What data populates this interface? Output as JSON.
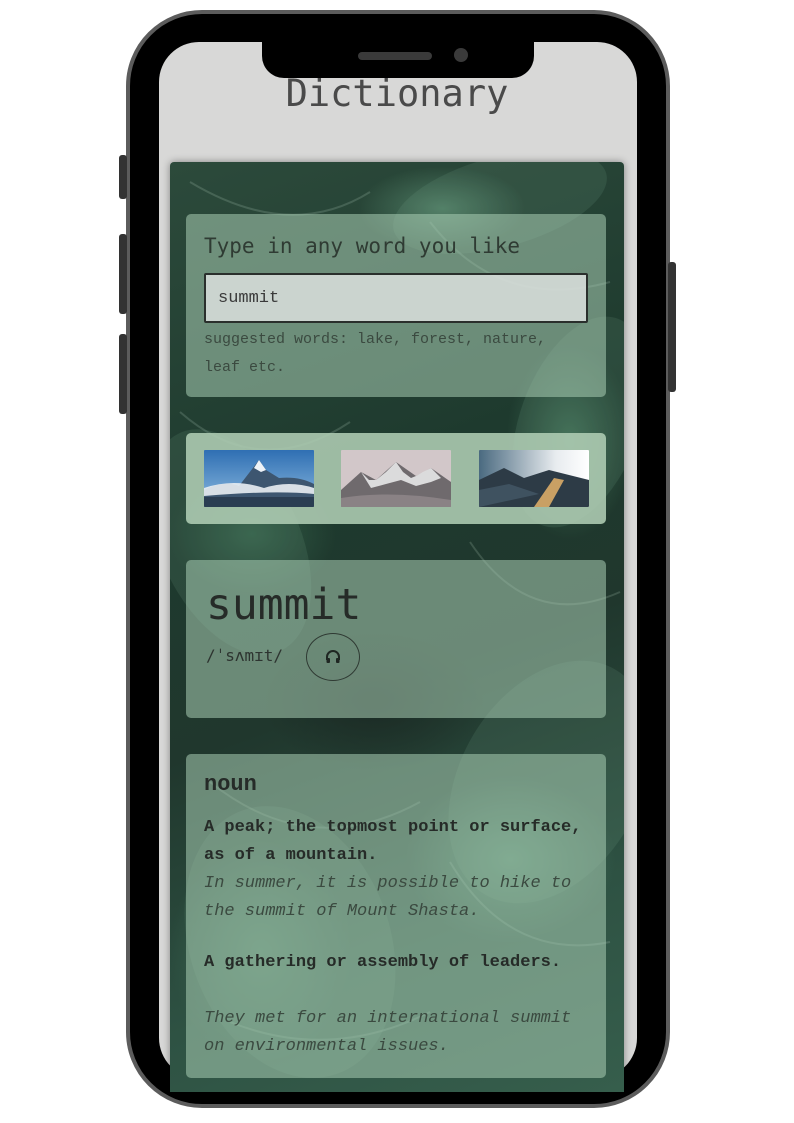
{
  "app": {
    "title": "Dictionary"
  },
  "search": {
    "prompt": "Type in any word you like",
    "value": "summit",
    "suggestions": "suggested words: lake, forest, nature, leaf etc."
  },
  "images": [
    {
      "icon": "mountain-photo-1"
    },
    {
      "icon": "mountain-photo-2"
    },
    {
      "icon": "mountain-photo-3"
    }
  ],
  "word": {
    "text": "summit",
    "phonetic": "/ˈsʌmɪt/",
    "audio_icon": "headphones-icon"
  },
  "meaning": {
    "part_of_speech": "noun",
    "definitions": [
      {
        "definition": "A peak; the topmost point or surface, as of a mountain.",
        "example": "In summer, it is possible to hike to the summit of Mount Shasta."
      },
      {
        "definition": "A gathering or assembly of leaders.",
        "example": "They met for an international summit on environmental issues."
      }
    ]
  },
  "colors": {
    "card_tint": "#aacdb4",
    "accent_text": "#262b28",
    "frame": "#5c5c5c"
  }
}
